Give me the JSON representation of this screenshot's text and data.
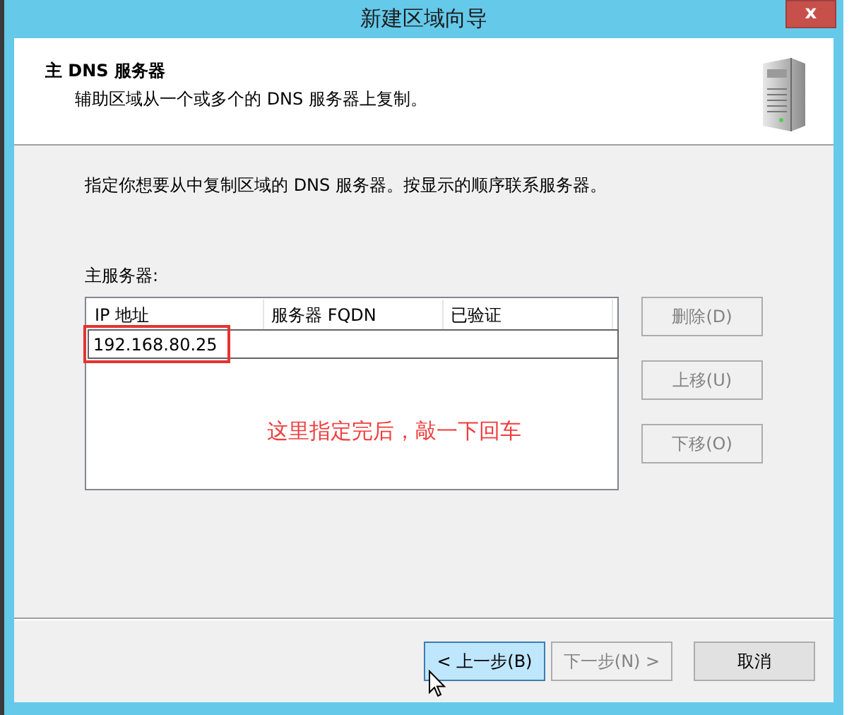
{
  "window": {
    "title": "新建区域向导",
    "close": "x"
  },
  "header": {
    "title": "主 DNS 服务器",
    "subtitle": "辅助区域从一个或多个的 DNS 服务器上复制。"
  },
  "instruction": "指定你想要从中复制区域的 DNS 服务器。按显示的顺序联系服务器。",
  "list_label": "主服务器:",
  "table": {
    "columns": [
      "IP 地址",
      "服务器 FQDN",
      "已验证"
    ],
    "rows": [
      {
        "ip": "192.168.80.25",
        "editing": true,
        "highlighted": true
      }
    ]
  },
  "annotation": "这里指定完后，敲一下回车",
  "side_buttons": [
    {
      "label": "删除(D)",
      "disabled": true
    },
    {
      "label": "上移(U)",
      "disabled": true
    },
    {
      "label": "下移(O)",
      "disabled": true
    }
  ],
  "footer_buttons": [
    {
      "label": "< 上一步(B)",
      "disabled": false,
      "highlighted": true
    },
    {
      "label": "下一步(N) >",
      "disabled": true,
      "highlighted": false
    },
    {
      "label": "取消",
      "disabled": false,
      "highlighted": false
    }
  ]
}
